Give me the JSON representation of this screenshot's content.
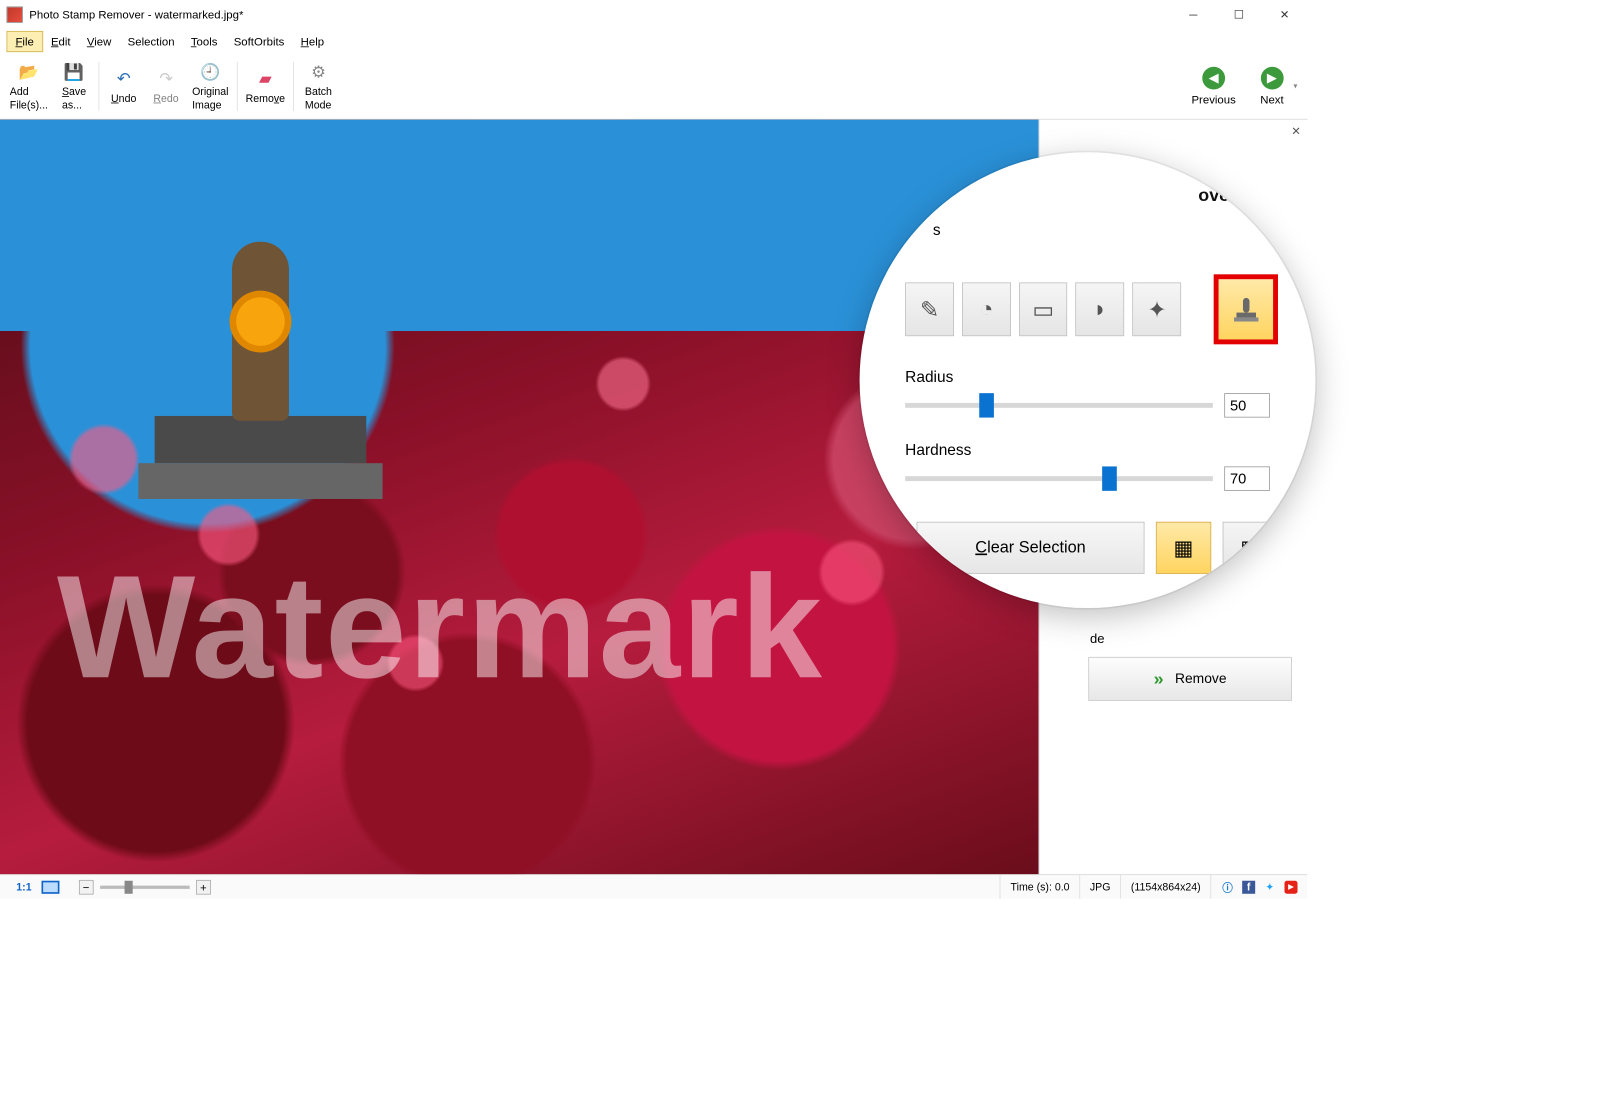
{
  "titlebar": {
    "app_name": "Photo Stamp Remover",
    "document": "watermarked.jpg*"
  },
  "menu": {
    "file": "File",
    "edit": "Edit",
    "view": "View",
    "selection": "Selection",
    "tools": "Tools",
    "softorbits": "SoftOrbits",
    "help": "Help"
  },
  "toolbar": {
    "add_files": "Add\nFile(s)...",
    "save_as": "Save\nas...",
    "undo": "Undo",
    "redo": "Redo",
    "original_image": "Original\nImage",
    "remove": "Remove",
    "batch_mode": "Batch\nMode",
    "previous": "Previous",
    "next": "Next"
  },
  "canvas": {
    "watermark_text": "Watermark"
  },
  "panel": {
    "heading_partial": "ove",
    "tools_label_partial": "s",
    "radius_label": "Radius",
    "radius_value": "50",
    "hardness_label": "Hardness",
    "hardness_value": "70",
    "clear_selection": "Clear Selection",
    "mode_label_partial": "de",
    "remove_button": "Remove"
  },
  "status": {
    "one_to_one": "1:1",
    "time": "Time (s): 0.0",
    "format": "JPG",
    "dimensions": "(1154x864x24)"
  },
  "colors": {
    "accent_blue": "#0a72d0",
    "highlight_red": "#e20000",
    "toolbar_highlight": "#fdeeb3"
  }
}
